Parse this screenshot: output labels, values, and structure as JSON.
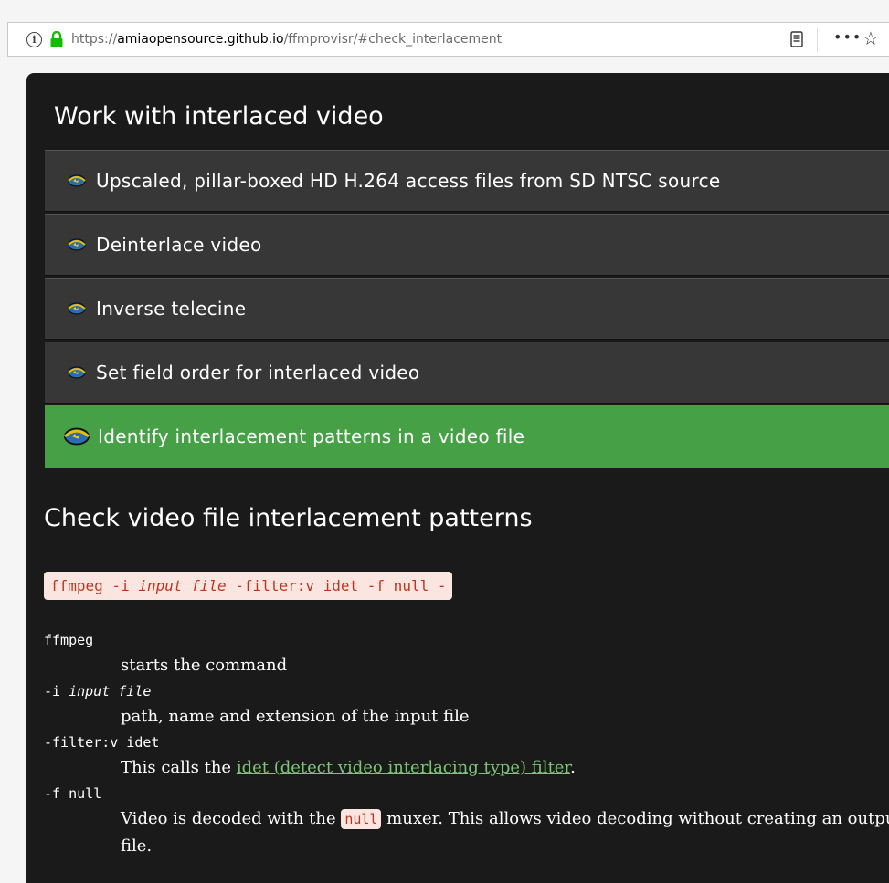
{
  "browser": {
    "url_scheme": "https://",
    "url_host": "amiaopensource.github.io",
    "url_path": "/ffmprovisr/#check_interlacement",
    "info_glyph": "i",
    "more_glyph": "•••",
    "star_glyph": "☆"
  },
  "section": {
    "title": "Work with interlaced video",
    "recipes": [
      {
        "label": "Upscaled, pillar-boxed HD H.264 access files from SD NTSC source",
        "active": false
      },
      {
        "label": "Deinterlace video",
        "active": false
      },
      {
        "label": "Inverse telecine",
        "active": false
      },
      {
        "label": "Set field order for interlaced video",
        "active": false
      },
      {
        "label": "Identify interlacement patterns in a video file",
        "active": true
      }
    ]
  },
  "recipe_detail": {
    "title": "Check video file interlacement patterns",
    "command": {
      "prefix": "ffmpeg -i ",
      "input_placeholder": "input file",
      "suffix": " -filter:v idet -f null -"
    },
    "definitions": [
      {
        "term": "ffmpeg",
        "desc": "starts the command"
      },
      {
        "term_prefix": "-i ",
        "term_var": "input_file",
        "desc": "path, name and extension of the input file"
      },
      {
        "term": "-filter:v idet",
        "desc_prefix": "This calls the ",
        "link_text": "idet (detect video interlacing type) filter",
        "desc_suffix": "."
      },
      {
        "term": "-f null",
        "desc_prefix": "Video is decoded with the ",
        "code": "null",
        "desc_suffix": " muxer. This allows video decoding without creating an output",
        "desc_line2": "file."
      }
    ]
  },
  "colors": {
    "page_bg": "#1a1a1a",
    "recipe_bg": "#373737",
    "recipe_active_bg": "#46a046",
    "code_bg": "#fbe5e1",
    "code_text": "#c0341d",
    "link": "#7fc27a"
  }
}
